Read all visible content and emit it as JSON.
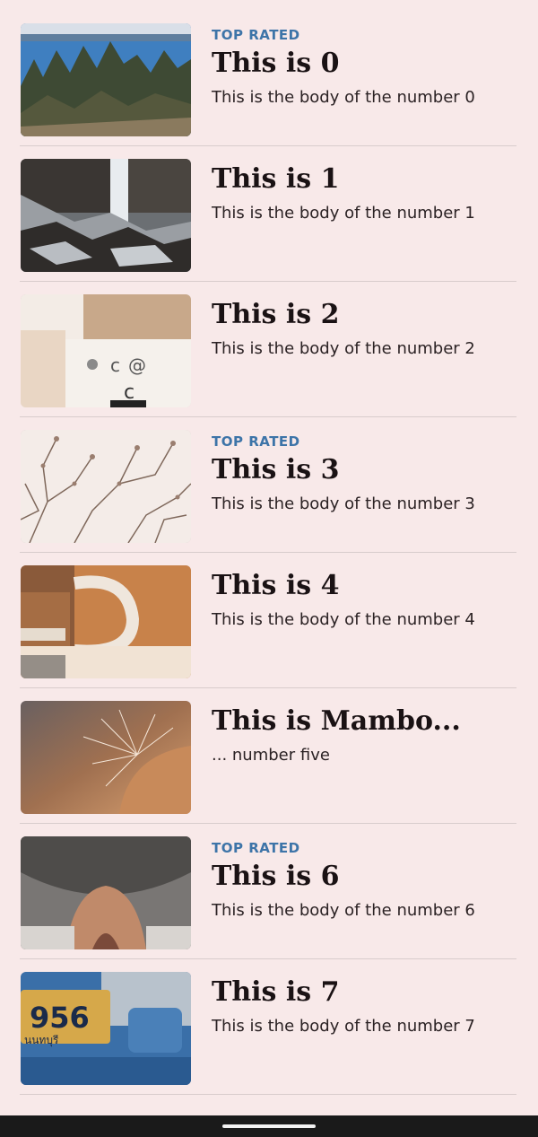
{
  "items": [
    {
      "badge": "TOP RATED",
      "title": "This is 0",
      "body": "This is the body of the number 0",
      "image": "forest-lake-photo"
    },
    {
      "badge": "",
      "title": "This is 1",
      "body": "This is the body of the number 1",
      "image": "waterfall-rocks-photo"
    },
    {
      "badge": "",
      "title": "This is 2",
      "body": "This is the body of the number 2",
      "image": "mugs-photo"
    },
    {
      "badge": "TOP RATED",
      "title": "This is 3",
      "body": "This is the body of the number 3",
      "image": "branches-photo"
    },
    {
      "badge": "",
      "title": "This is 4",
      "body": "This is the body of the number 4",
      "image": "mug-closeup-photo"
    },
    {
      "badge": "",
      "title": "This is Mambo...",
      "body": "... number five",
      "image": "cat-whiskers-photo"
    },
    {
      "badge": "TOP RATED",
      "title": "This is 6",
      "body": "This is the body of the number 6",
      "image": "cat-nose-photo"
    },
    {
      "badge": "",
      "title": "This is 7",
      "body": "This is the body of the number 7",
      "image": "license-plate-photo"
    }
  ],
  "colors": {
    "background": "#f8e9e9",
    "badge": "#3d74a8",
    "title": "#1a1214",
    "divider": "#d8cccc"
  }
}
